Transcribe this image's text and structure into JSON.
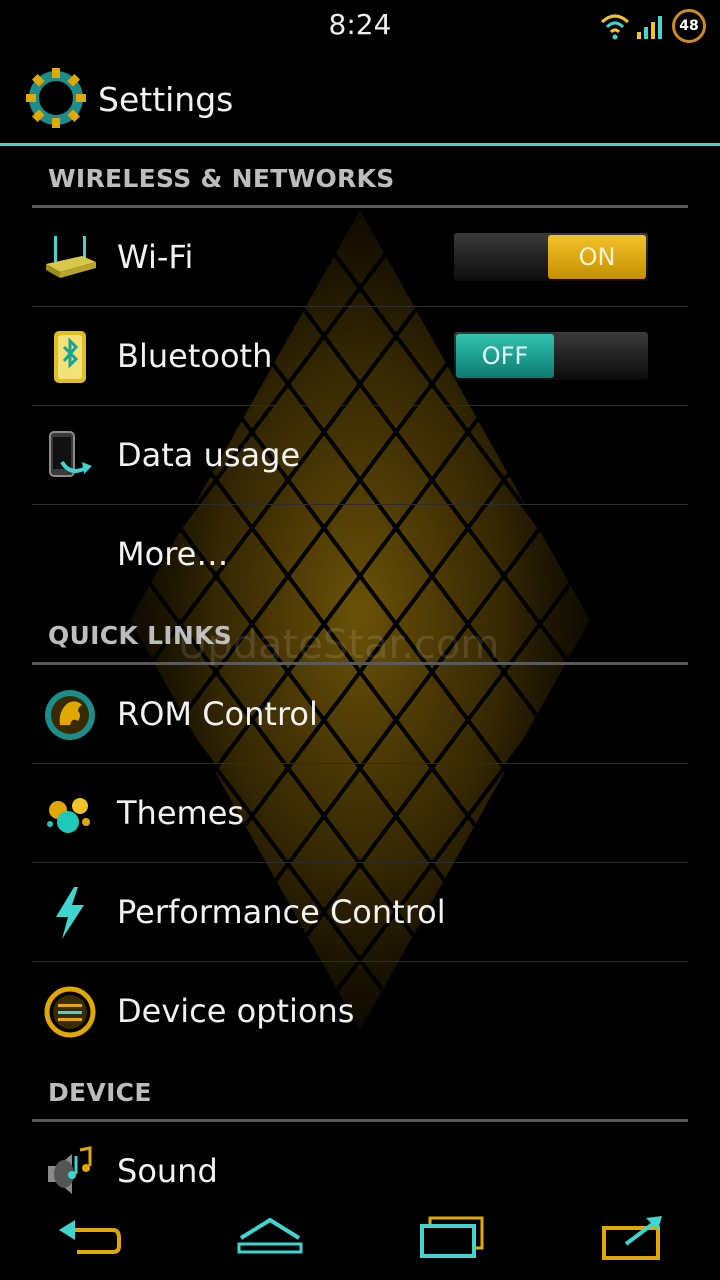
{
  "status_bar": {
    "time": "8:24",
    "battery_level": "48"
  },
  "action_bar": {
    "title": "Settings",
    "icon": "gear-icon"
  },
  "sections": [
    {
      "header": "WIRELESS & NETWORKS",
      "items": [
        {
          "label": "Wi-Fi",
          "icon": "wifi-router-icon",
          "toggle": "ON"
        },
        {
          "label": "Bluetooth",
          "icon": "bluetooth-icon",
          "toggle": "OFF"
        },
        {
          "label": "Data usage",
          "icon": "data-usage-icon"
        },
        {
          "label": "More…",
          "icon": ""
        }
      ]
    },
    {
      "header": "QUICK LINKS",
      "items": [
        {
          "label": "ROM Control",
          "icon": "rom-control-icon"
        },
        {
          "label": "Themes",
          "icon": "themes-icon"
        },
        {
          "label": "Performance Control",
          "icon": "lightning-icon"
        },
        {
          "label": "Device options",
          "icon": "device-options-icon"
        }
      ]
    },
    {
      "header": "DEVICE",
      "items": [
        {
          "label": "Sound",
          "icon": "speaker-icon"
        }
      ]
    }
  ],
  "watermark": "UpdateStar.com",
  "nav_bar": {
    "buttons": [
      "back-icon",
      "home-icon",
      "recents-icon",
      "menu-icon"
    ]
  },
  "colors": {
    "accent": "#3fd6d0",
    "toggle_on": "#e0a800",
    "toggle_off": "#1aa394",
    "background": "#000000"
  }
}
